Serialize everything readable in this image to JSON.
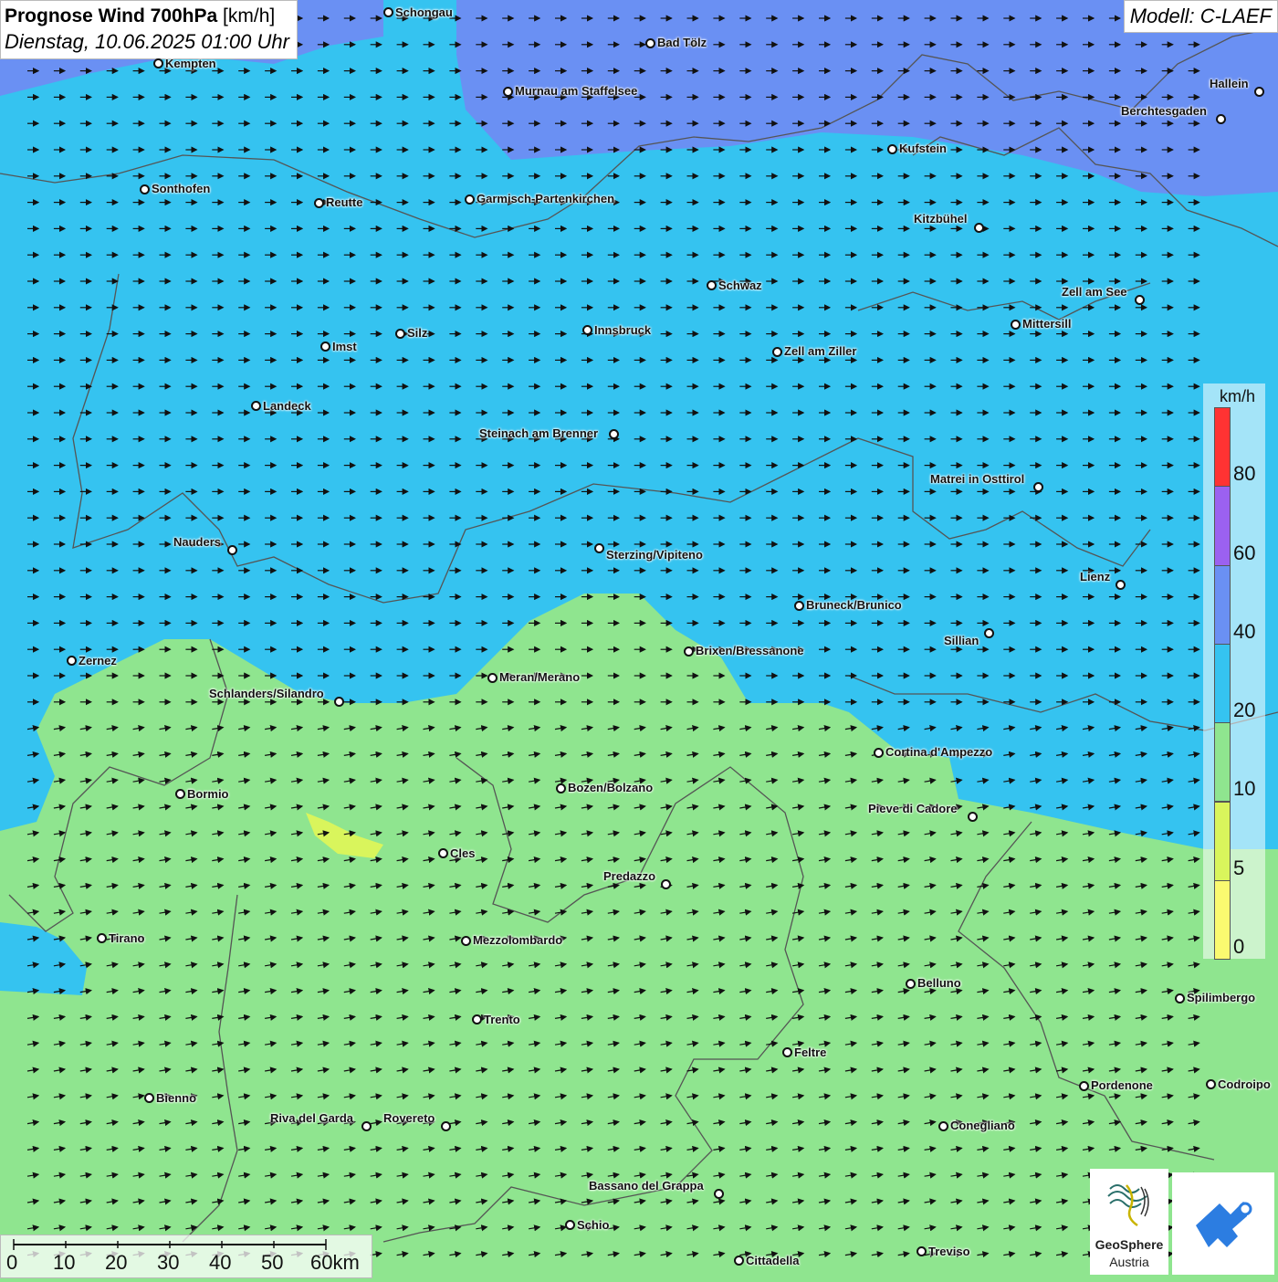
{
  "header": {
    "title_bold": "Prognose Wind 700hPa",
    "title_unit": "[km/h]",
    "datetime": "Dienstag, 10.06.2025 01:00 Uhr"
  },
  "model_label": "Modell: C-LAEF",
  "legend": {
    "unit": "km/h",
    "labels": [
      "80",
      "60",
      "40",
      "20",
      "10",
      "5",
      "0"
    ],
    "colors": [
      "#ff3333",
      "#9b61f0",
      "#6a90f3",
      "#35c3f0",
      "#8fe58f",
      "#d9f55c",
      "#fafa70"
    ]
  },
  "scale_bar": {
    "labels": [
      "0",
      "10",
      "20",
      "30",
      "40",
      "50",
      "60km"
    ]
  },
  "logos": {
    "geosphere_name": "GeoSphere",
    "geosphere_sub": "Austria",
    "geosphere_icon": "geosphere-logo-icon",
    "app_icon": "weather-app-logo-icon"
  },
  "colors": {
    "wind_0_5": "#fafa70",
    "wind_5_10": "#d9f55c",
    "wind_10_20": "#8fe58f",
    "wind_20_40": "#35c3f0",
    "wind_40_60": "#6a90f3",
    "wind_60_80": "#9b61f0",
    "wind_80_plus": "#ff3333",
    "border_lines": "#555555"
  },
  "cities": [
    {
      "name": "Schongau"
    },
    {
      "name": "Bad Tölz"
    },
    {
      "name": "Kempten"
    },
    {
      "name": "Murnau am Staffelsee"
    },
    {
      "name": "Hallein"
    },
    {
      "name": "Berchtesgaden"
    },
    {
      "name": "Kufstein"
    },
    {
      "name": "Sonthofen"
    },
    {
      "name": "Reutte"
    },
    {
      "name": "Garmisch-Partenkirchen"
    },
    {
      "name": "Kitzbühel"
    },
    {
      "name": "Schwaz"
    },
    {
      "name": "Zell am See"
    },
    {
      "name": "Mittersill"
    },
    {
      "name": "Innsbruck"
    },
    {
      "name": "Silz"
    },
    {
      "name": "Imst"
    },
    {
      "name": "Zell am Ziller"
    },
    {
      "name": "Landeck"
    },
    {
      "name": "Steinach am Brenner"
    },
    {
      "name": "Matrei in Osttirol"
    },
    {
      "name": "Nauders"
    },
    {
      "name": "Sterzing/Vipiteno"
    },
    {
      "name": "Lienz"
    },
    {
      "name": "Bruneck/Brunico"
    },
    {
      "name": "Sillian"
    },
    {
      "name": "Zernez"
    },
    {
      "name": "Brixen/Bressanone"
    },
    {
      "name": "Meran/Merano"
    },
    {
      "name": "Schlanders/Silandro"
    },
    {
      "name": "Cortina d'Ampezzo"
    },
    {
      "name": "Bozen/Bolzano"
    },
    {
      "name": "Bormio"
    },
    {
      "name": "Pieve di Cadore"
    },
    {
      "name": "Cles"
    },
    {
      "name": "Predazzo"
    },
    {
      "name": "Tirano"
    },
    {
      "name": "Mezzolombardo"
    },
    {
      "name": "Belluno"
    },
    {
      "name": "Spilimbergo"
    },
    {
      "name": "Trento"
    },
    {
      "name": "Feltre"
    },
    {
      "name": "Pordenone"
    },
    {
      "name": "Codroipo"
    },
    {
      "name": "Bienno"
    },
    {
      "name": "Riva del Garda"
    },
    {
      "name": "Rovereto"
    },
    {
      "name": "Conegliano"
    },
    {
      "name": "Bassano del Grappa"
    },
    {
      "name": "Schio"
    },
    {
      "name": "Treviso"
    },
    {
      "name": "Cittadella"
    }
  ]
}
